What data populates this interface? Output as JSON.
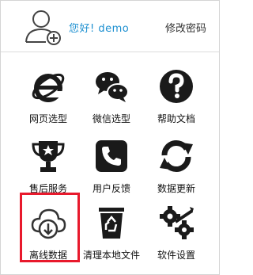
{
  "header": {
    "greeting": "您好! demo",
    "change_password": "修改密码"
  },
  "tiles": [
    {
      "label": "网页选型",
      "icon": "ie-browser-icon"
    },
    {
      "label": "微信选型",
      "icon": "wechat-icon"
    },
    {
      "label": "帮助文档",
      "icon": "help-icon"
    },
    {
      "label": "售后服务",
      "icon": "trophy-icon"
    },
    {
      "label": "用户反馈",
      "icon": "phone-icon"
    },
    {
      "label": "数据更新",
      "icon": "refresh-icon"
    },
    {
      "label": "离线数据",
      "icon": "cloud-download-icon"
    },
    {
      "label": "清理本地文件",
      "icon": "recycle-bin-icon"
    },
    {
      "label": "软件设置",
      "icon": "settings-gears-icon"
    }
  ],
  "colors": {
    "accent": "#1c8fd0",
    "highlight": "#e8192c",
    "icon": "#1a1a1a"
  }
}
